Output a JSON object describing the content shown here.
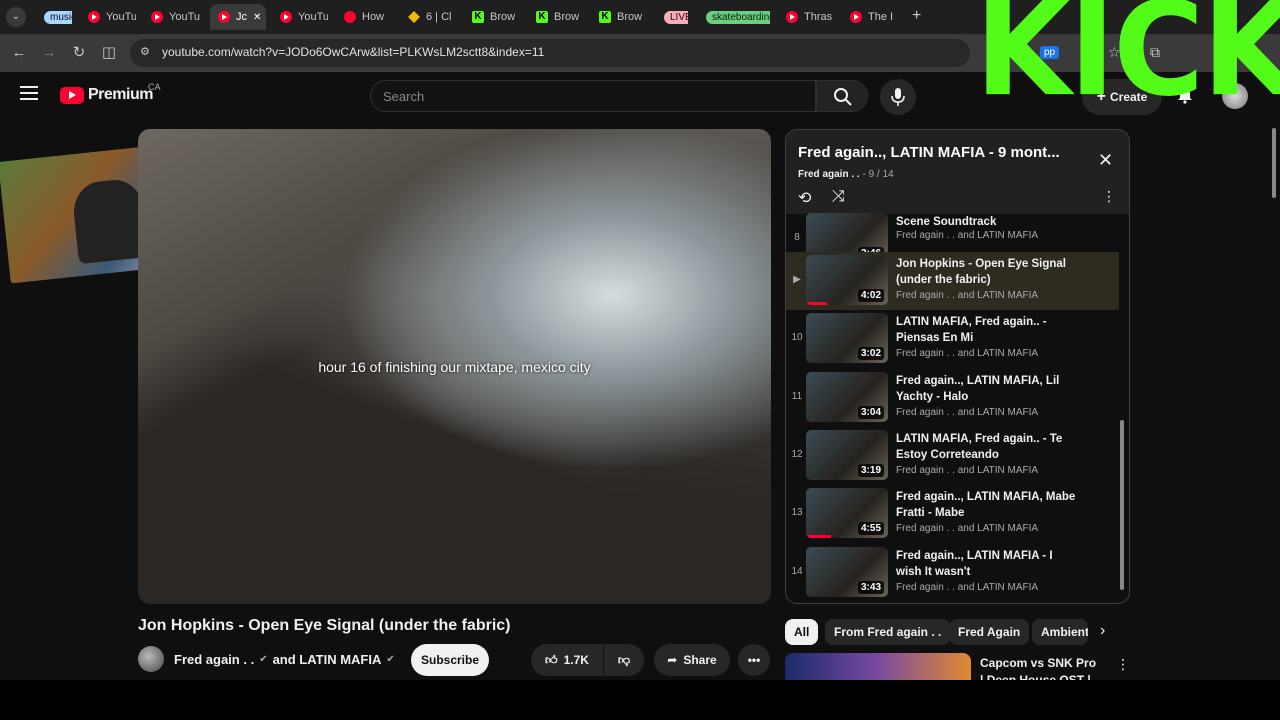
{
  "browser": {
    "tabs": [
      {
        "label": "music",
        "kind": "group",
        "color": "#8ab4f8"
      },
      {
        "label": "YouTu",
        "kind": "yt"
      },
      {
        "label": "YouTu",
        "kind": "yt"
      },
      {
        "label": "Jc",
        "kind": "yt",
        "active": true
      },
      {
        "label": "YouTu",
        "kind": "yt"
      },
      {
        "label": "How",
        "kind": "dot"
      },
      {
        "label": "6 | Cl",
        "kind": "bn"
      },
      {
        "label": "Brow",
        "kind": "k"
      },
      {
        "label": "Brow",
        "kind": "k"
      },
      {
        "label": "Brow",
        "kind": "k"
      },
      {
        "label": "LIVE",
        "kind": "live"
      },
      {
        "label": "skateboarding",
        "kind": "group2"
      },
      {
        "label": "Thras",
        "kind": "yt"
      },
      {
        "label": "The I",
        "kind": "yt"
      }
    ],
    "new_tab": "+",
    "url": "youtube.com/watch?v=JODo6OwCArw&list=PLKWsLM2sctt8&index=11",
    "extension_label": "pp"
  },
  "overlay": {
    "kick_text": "KICK"
  },
  "header": {
    "logo_text": "Premium",
    "region": "CA",
    "search_placeholder": "Search",
    "create_label": "Create"
  },
  "video": {
    "subtitle": "hour 16 of finishing our mixtape, mexico city",
    "title": "Jon Hopkins - Open Eye Signal (under the fabric)",
    "channel": "Fred again . .",
    "channel_and": "and LATIN MAFIA",
    "subscribe": "Subscribe",
    "likes": "1.7K",
    "share": "Share"
  },
  "playlist": {
    "title": "Fred again.., LATIN MAFIA - 9 mont...",
    "channel": "Fred again . .",
    "position": "- 9 / 14",
    "items": [
      {
        "index": "8",
        "title": "Scene Soundtrack",
        "channel": "Fred again . . and LATIN MAFIA",
        "duration": "2:46",
        "progress": 1.0
      },
      {
        "index": "▶",
        "title": "Jon Hopkins - Open Eye Signal (under the fabric)",
        "channel": "Fred again . . and LATIN MAFIA",
        "duration": "4:02",
        "progress": 0.25,
        "active": true
      },
      {
        "index": "10",
        "title": "LATIN MAFIA, Fred again.. - Piensas En Mi",
        "channel": "Fred again . . and LATIN MAFIA",
        "duration": "3:02",
        "progress": 0
      },
      {
        "index": "11",
        "title": "Fred again.., LATIN MAFIA, Lil Yachty - Halo",
        "channel": "Fred again . . and LATIN MAFIA",
        "duration": "3:04",
        "progress": 0
      },
      {
        "index": "12",
        "title": "LATIN MAFIA, Fred again.. - Te Estoy Correteando",
        "channel": "Fred again . . and LATIN MAFIA",
        "duration": "3:19",
        "progress": 0
      },
      {
        "index": "13",
        "title": "Fred again.., LATIN MAFIA, Mabe Fratti - Mabe",
        "channel": "Fred again . . and LATIN MAFIA",
        "duration": "4:55",
        "progress": 0.3
      },
      {
        "index": "14",
        "title": "Fred again.., LATIN MAFIA - I wish It wasn't",
        "channel": "Fred again . . and LATIN MAFIA",
        "duration": "3:43",
        "progress": 0
      }
    ]
  },
  "chips": [
    "All",
    "From Fred again . .",
    "Fred Again",
    "Ambient"
  ],
  "recommendation": {
    "title": "Capcom vs SNK Pro | Deep House OST |"
  },
  "colors": {
    "accent": "#ff0033",
    "kick_green": "#53fc18"
  }
}
